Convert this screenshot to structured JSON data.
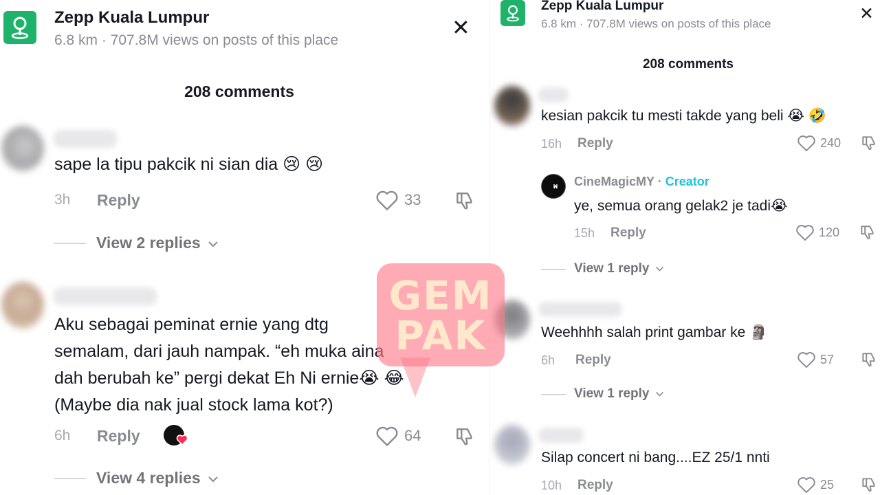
{
  "colors": {
    "accent_green": "#1fb26b",
    "creator_cyan": "#20c2d8",
    "text_primary": "#161823",
    "text_secondary": "#8a8b91"
  },
  "icons": {
    "location": "map-pin-icon",
    "close": "close-icon",
    "like": "heart-icon",
    "dislike": "thumbs-down-icon",
    "expand": "chevron-down-icon"
  },
  "left": {
    "place": {
      "title": "Zepp Kuala Lumpur",
      "subtitle": "6.8 km · 707.8M views on posts of this place"
    },
    "close": "✕",
    "comment_count": "208 comments",
    "comments": [
      {
        "text": "sape la tipu pakcik ni sian dia 😢 😢",
        "time": "3h",
        "reply": "Reply",
        "likes": "33",
        "view_replies": "View 2 replies"
      },
      {
        "text_lines": [
          "Aku sebagai peminat ernie yang dtg",
          "semalam, dari jauh nampak. “eh muka aina",
          "dah berubah ke” pergi dekat Eh Ni ernie😭 😂",
          "(Maybe dia nak jual stock lama kot?)"
        ],
        "time": "6h",
        "reply": "Reply",
        "likes": "64",
        "view_replies": "View 4 replies"
      }
    ]
  },
  "right": {
    "place": {
      "title": "Zepp Kuala Lumpur",
      "subtitle": "6.8 km · 707.8M views on posts of this place"
    },
    "close": "✕",
    "comment_count": "208 comments",
    "comments": [
      {
        "text": "kesian pakcik tu mesti takde yang beli 😭 🤣",
        "time": "16h",
        "reply": "Reply",
        "likes": "240",
        "creator_reply": {
          "name": "CineMagicMY",
          "sep": " · ",
          "tag": "Creator",
          "text": "ye, semua orang gelak2 je tadi😭",
          "time": "15h",
          "reply": "Reply",
          "likes": "120"
        },
        "view_replies": "View 1 reply"
      },
      {
        "text": "Weehhhh salah print gambar ke 🗿",
        "time": "6h",
        "reply": "Reply",
        "likes": "57",
        "view_replies": "View 1 reply"
      },
      {
        "text": "Silap concert ni bang....EZ 25/1 nnti",
        "time": "10h",
        "reply": "Reply",
        "likes": "25"
      }
    ]
  },
  "watermark": {
    "line1": "GEM",
    "line2": "PAK"
  }
}
